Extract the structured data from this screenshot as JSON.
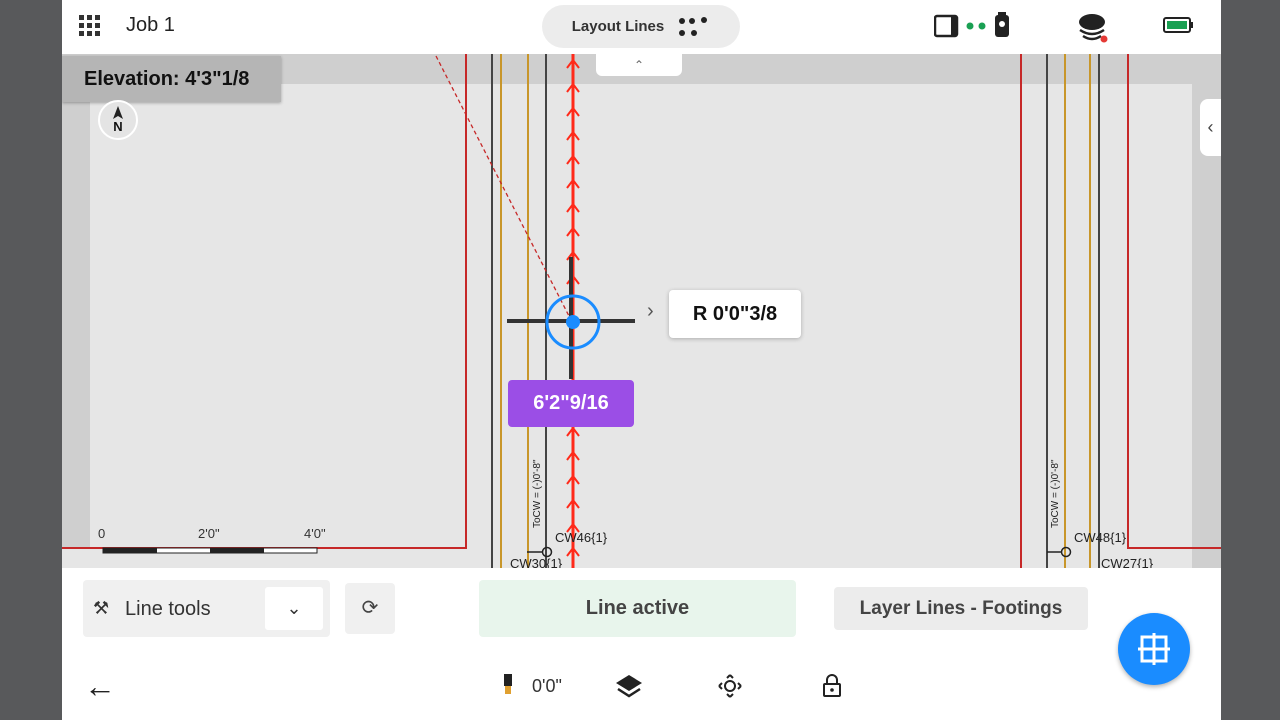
{
  "header": {
    "grid_icon": "apps-grid-icon",
    "job_title": "Job 1",
    "mode_label": "Layout Lines",
    "mode_icon": "dots-menu-icon",
    "status_icons": [
      "tablet-icon",
      "connection-dots-icon",
      "total-station-icon",
      "cloud-sync-icon",
      "battery-icon"
    ]
  },
  "map": {
    "elevation": "Elevation: 4'3\"1/8",
    "north_label": "N",
    "offset": "R 0'0\"3/8",
    "distance": "6'2\"9/16",
    "scale_labels": [
      "0",
      "2'0\"",
      "4'0\""
    ],
    "tocw_labels": [
      "ToCW = (-)0'-8\"",
      "ToCW = (-)0'-8\""
    ],
    "point_labels": [
      "CW46{1}",
      "CW30{1}",
      "CW48{1}",
      "CW27{1}"
    ],
    "colors": {
      "cut_line": "#e53935",
      "selected_line": "#ff2a1a",
      "gold_line": "#c8962a",
      "crosshair_ring": "#1a8cff"
    }
  },
  "toolbar": {
    "line_tools_label": "Line tools",
    "line_active_label": "Line active",
    "layer_label": "Layer Lines - Footings",
    "height_value": "0'0\""
  }
}
